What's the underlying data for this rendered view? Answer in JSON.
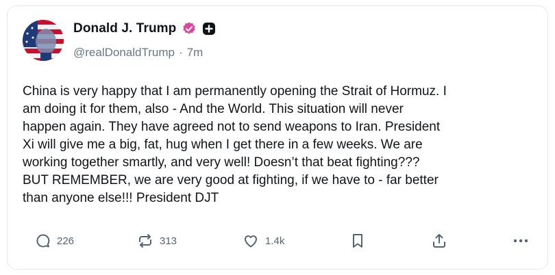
{
  "author": {
    "display_name": "Donald J. Trump",
    "handle": "@realDonaldTrump",
    "separator": "·",
    "time": "7m"
  },
  "post": {
    "text": "China is very happy that I am permanently opening the Strait of Hormuz. I\nam doing it for them, also - And the World. This situation will never\nhappen again. They have agreed not to send weapons to Iran. President\nXi will give me a big, fat, hug when I get there in a few weeks. We are\nworking together smartly, and very well! Doesn’t that beat fighting???\nBUT REMEMBER, we are very good at fighting, if we have to - far better\nthan anyone else!!! President DJT"
  },
  "actions": {
    "replies": "226",
    "reposts": "313",
    "likes": "1.4k"
  },
  "icons": {
    "verified": "verified-badge-icon",
    "plus": "plus-square-icon",
    "reply": "comment-icon",
    "repost": "repost-icon",
    "like": "heart-icon",
    "bookmark": "bookmark-icon",
    "share": "share-icon",
    "more": "more-icon"
  },
  "colors": {
    "verified": "#d9489a",
    "text": "#0f1419",
    "muted": "#536471"
  }
}
